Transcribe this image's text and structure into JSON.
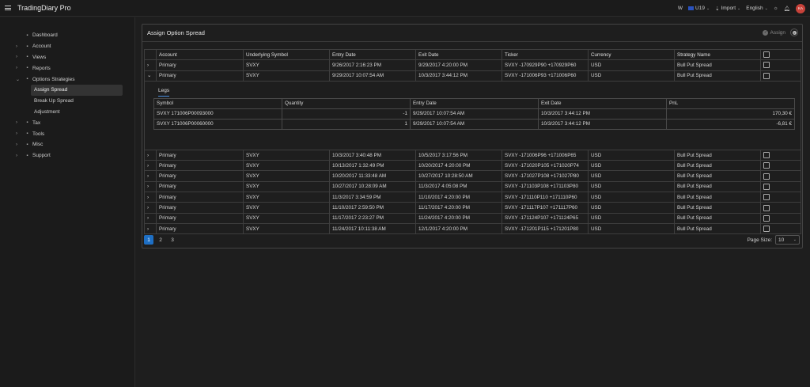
{
  "app": {
    "title": "TradingDiary Pro"
  },
  "topbar": {
    "workspace": "W",
    "account": "U19",
    "import_label": "Import",
    "language": "English",
    "avatar_initials": "KA",
    "avatar_color": "#c8423a"
  },
  "sidebar": {
    "items": [
      {
        "label": "Dashboard",
        "icon": "chart-icon",
        "arrow": ""
      },
      {
        "label": "Account",
        "icon": "wallet-icon",
        "arrow": "›"
      },
      {
        "label": "Views",
        "icon": "eye-icon",
        "arrow": "›"
      },
      {
        "label": "Reports",
        "icon": "report-icon",
        "arrow": "›"
      },
      {
        "label": "Options Strategies",
        "icon": "list-icon",
        "arrow": "⌄"
      },
      {
        "label": "Assign Spread",
        "sub": true,
        "active": true
      },
      {
        "label": "Break Up Spread",
        "sub": true
      },
      {
        "label": "Adjustment",
        "sub": true
      },
      {
        "label": "Tax",
        "icon": "tax-icon",
        "arrow": "›"
      },
      {
        "label": "Tools",
        "icon": "tools-icon",
        "arrow": "›"
      },
      {
        "label": "Misc",
        "icon": "misc-icon",
        "arrow": "›"
      },
      {
        "label": "Support",
        "icon": "support-icon",
        "arrow": "›"
      }
    ]
  },
  "panel": {
    "title": "Assign Option Spread",
    "assign_label": "Assign"
  },
  "table": {
    "columns": [
      "Account",
      "Underlying Symbol",
      "Entry Date",
      "Exit Date",
      "Ticker",
      "Currency",
      "Strategy Name"
    ],
    "rows": [
      {
        "account": "Primary",
        "symbol": "SVXY",
        "entry": "9/26/2017 2:16:23 PM",
        "exit": "9/29/2017 4:20:00 PM",
        "ticker": "SVXY -170929P90 +170929P60",
        "currency": "USD",
        "strategy": "Bull Put Spread",
        "expanded": false
      },
      {
        "account": "Primary",
        "symbol": "SVXY",
        "entry": "9/29/2017 10:07:54 AM",
        "exit": "10/3/2017 3:44:12 PM",
        "ticker": "SVXY -171006P93 +171006P60",
        "currency": "USD",
        "strategy": "Bull Put Spread",
        "expanded": true
      },
      {
        "account": "Primary",
        "symbol": "SVXY",
        "entry": "10/3/2017 3:40:48 PM",
        "exit": "10/5/2017 3:17:56 PM",
        "ticker": "SVXY -171006P96 +171006P65",
        "currency": "USD",
        "strategy": "Bull Put Spread",
        "expanded": false
      },
      {
        "account": "Primary",
        "symbol": "SVXY",
        "entry": "10/13/2017 1:32:49 PM",
        "exit": "10/20/2017 4:20:00 PM",
        "ticker": "SVXY -171020P105 +171020P74",
        "currency": "USD",
        "strategy": "Bull Put Spread",
        "expanded": false
      },
      {
        "account": "Primary",
        "symbol": "SVXY",
        "entry": "10/20/2017 11:33:48 AM",
        "exit": "10/27/2017 10:28:50 AM",
        "ticker": "SVXY -171027P108 +171027P80",
        "currency": "USD",
        "strategy": "Bull Put Spread",
        "expanded": false
      },
      {
        "account": "Primary",
        "symbol": "SVXY",
        "entry": "10/27/2017 10:28:09 AM",
        "exit": "11/3/2017 4:05:08 PM",
        "ticker": "SVXY -171103P108 +171103P80",
        "currency": "USD",
        "strategy": "Bull Put Spread",
        "expanded": false
      },
      {
        "account": "Primary",
        "symbol": "SVXY",
        "entry": "11/3/2017 3:34:59 PM",
        "exit": "11/10/2017 4:20:00 PM",
        "ticker": "SVXY -171110P110 +171110P60",
        "currency": "USD",
        "strategy": "Bull Put Spread",
        "expanded": false
      },
      {
        "account": "Primary",
        "symbol": "SVXY",
        "entry": "11/10/2017 2:59:50 PM",
        "exit": "11/17/2017 4:20:00 PM",
        "ticker": "SVXY -171117P107 +171117P60",
        "currency": "USD",
        "strategy": "Bull Put Spread",
        "expanded": false
      },
      {
        "account": "Primary",
        "symbol": "SVXY",
        "entry": "11/17/2017 2:23:27 PM",
        "exit": "11/24/2017 4:20:00 PM",
        "ticker": "SVXY -171124P107 +171124P65",
        "currency": "USD",
        "strategy": "Bull Put Spread",
        "expanded": false
      },
      {
        "account": "Primary",
        "symbol": "SVXY",
        "entry": "11/24/2017 10:11:38 AM",
        "exit": "12/1/2017 4:20:00 PM",
        "ticker": "SVXY -171201P115 +171201P80",
        "currency": "USD",
        "strategy": "Bull Put Spread",
        "expanded": false
      }
    ]
  },
  "legs": {
    "tab_label": "Legs",
    "columns": [
      "Symbol",
      "Quantity",
      "Entry Date",
      "Exit Date",
      "PnL"
    ],
    "rows": [
      {
        "symbol": "SVXY 171006P00093000",
        "quantity": "-1",
        "entry": "9/29/2017 10:07:54 AM",
        "exit": "10/3/2017 3:44:12 PM",
        "pnl": "170,30 €"
      },
      {
        "symbol": "SVXY 171006P00060000",
        "quantity": "1",
        "entry": "9/29/2017 10:07:54 AM",
        "exit": "10/3/2017 3:44:12 PM",
        "pnl": "-6,81 €"
      }
    ]
  },
  "pager": {
    "pages": [
      "1",
      "2",
      "3"
    ],
    "current": "1",
    "page_size_label": "Page Size:",
    "page_size": "10"
  }
}
